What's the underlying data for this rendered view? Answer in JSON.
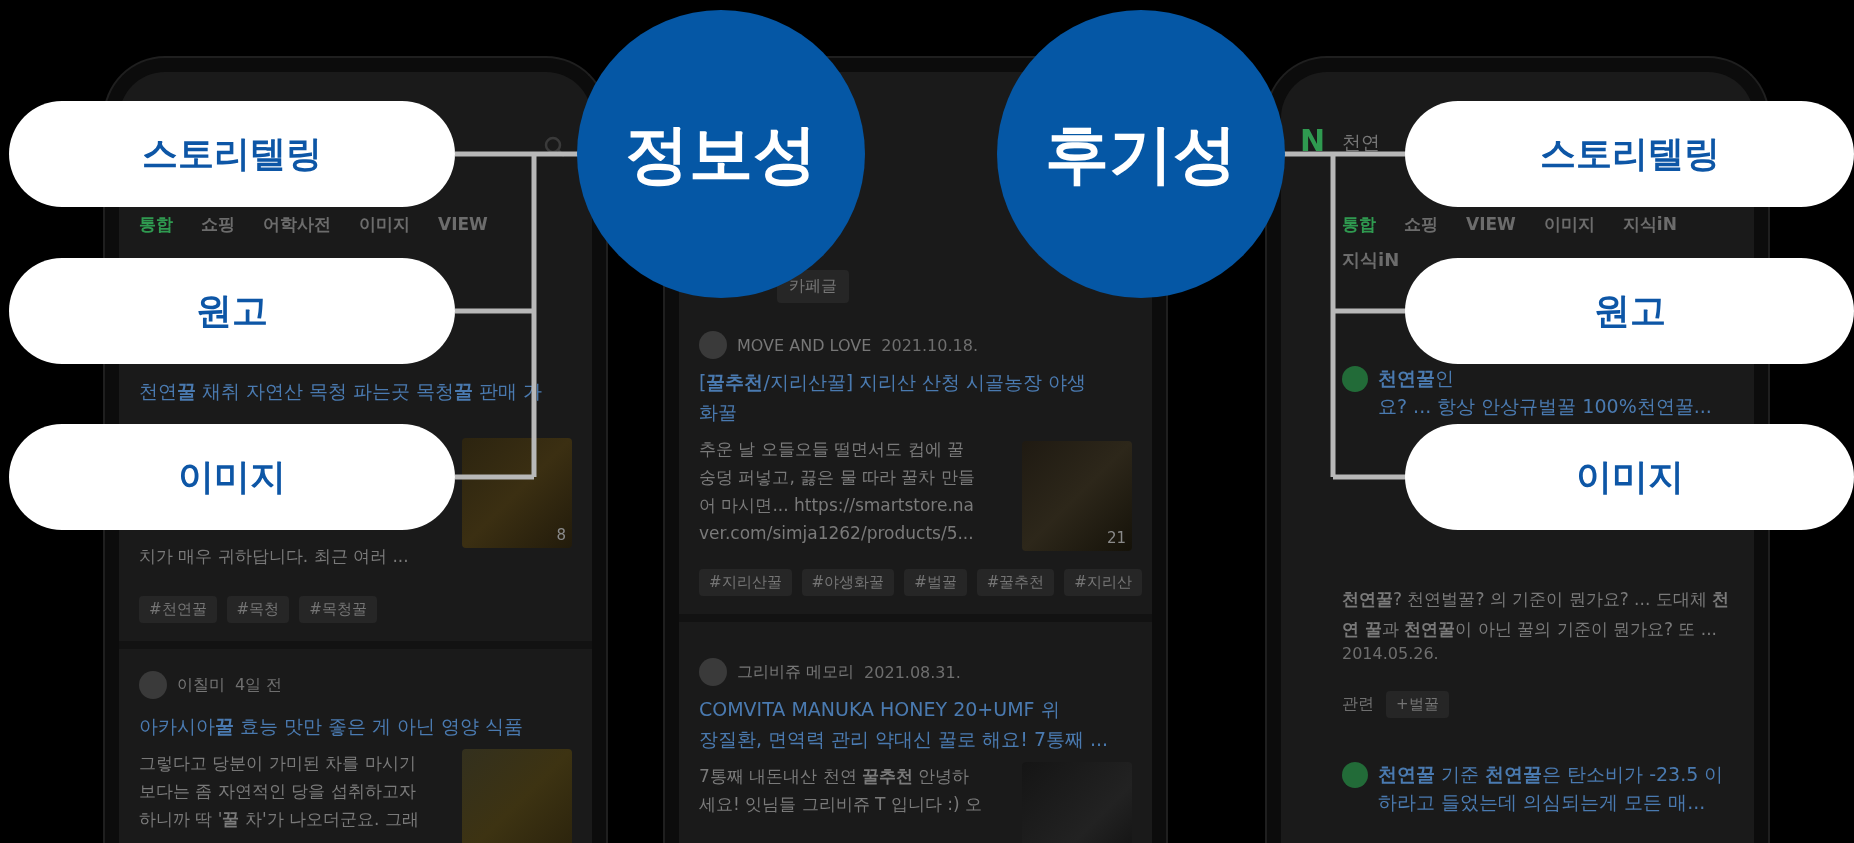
{
  "left_labels": [
    "스토리텔링",
    "원고",
    "이미지"
  ],
  "categories": [
    {
      "text": "정보성"
    },
    {
      "text": "후기성"
    }
  ],
  "right_labels": [
    "스토리텔링",
    "원고",
    "이미지"
  ],
  "left_phone": {
    "tabs": [
      {
        "label": "통합",
        "selected": true
      },
      {
        "label": "쇼핑",
        "selected": false
      },
      {
        "label": "어학사전",
        "selected": false
      },
      {
        "label": "이미지",
        "selected": false
      },
      {
        "label": "VIEW",
        "selected": false
      }
    ],
    "post1": {
      "title": "천연**꿀** 채취 자연산 목청 파는곳 목청**꿀** 판매 가",
      "snippet": "치가 매우 귀하답니다. 최근 여러 ...",
      "image_count": "8",
      "tags": [
        "#천연꿀",
        "#목청",
        "#목청꿀"
      ]
    },
    "post2": {
      "author": "이칠미",
      "time": "4일 전",
      "title": "아카시아**꿀** 효능 맛만 좋은 게 아닌 영양 식품",
      "snippet": [
        "그렇다고 당분이 가미된 차를 마시기",
        "보다는 좀 자연적인 당을 섭취하고자",
        "하니까 딱 '**꿀** 차'가 나오더군요. 그래"
      ]
    }
  },
  "center_phone": {
    "chip": "카페글",
    "posts": [
      {
        "author": "MOVE AND LOVE",
        "date": "2021.10.18.",
        "title": [
          "[**꿀추천**/지리산꿀] 지리산 산청 시골농장 야생",
          "화꿀"
        ],
        "snippet": [
          "추운 날 오들오들 떨면서도 컵에 꿀",
          "숭덩 퍼넣고, 끓은 물 따라 꿀차 만들",
          "어 마시면... https://smartstore.na",
          "ver.com/simja1262/products/5..."
        ],
        "image_count": "21",
        "tags": [
          "#지리산꿀",
          "#야생화꿀",
          "#벌꿀",
          "#꿀추천",
          "#지리산"
        ]
      },
      {
        "author": "그리비쥬 메모리",
        "date": "2021.08.31.",
        "title": [
          "COMVITA MANUKA HONEY 20+UMF 위",
          "장질환, 면역력 관리 약대신 꿀로 해요! 7통째 ..."
        ],
        "snippet": [
          "7통째 내돈내산 천연 **꿀추천** 안녕하",
          "세요! 잇님들 그리비쥬 T 입니다 :) 오"
        ]
      }
    ]
  },
  "right_phone": {
    "logo": "N",
    "query": "천연",
    "tabs": [
      {
        "label": "통합",
        "selected": true
      },
      {
        "label": "쇼핑",
        "selected": false
      },
      {
        "label": "VIEW",
        "selected": false
      },
      {
        "label": "이미지",
        "selected": false
      },
      {
        "label": "지식iN",
        "selected": false
      }
    ],
    "section": "지식iN",
    "q1": {
      "title": "**천연꿀**인",
      "line2": "요? ... 항상 안상규벌꿀 100%천연꿀..."
    },
    "q2": {
      "text": "**천연꿀**? 천연벌꿀? 의 기준이 뭔가요? ... 도대체 **천연 꿀**과 **천연꿀**이 아닌 꿀의 기준이 뭔가요? 또 ...",
      "date": "2014.05.26."
    },
    "related": {
      "label": "관련",
      "tag": "+벌꿀"
    },
    "q3": {
      "text": "**천연꿀** 기준 **천연꿀**은 탄소비가 -23.5 이하라고 들었는데 의심되는게 모든 매..."
    }
  }
}
